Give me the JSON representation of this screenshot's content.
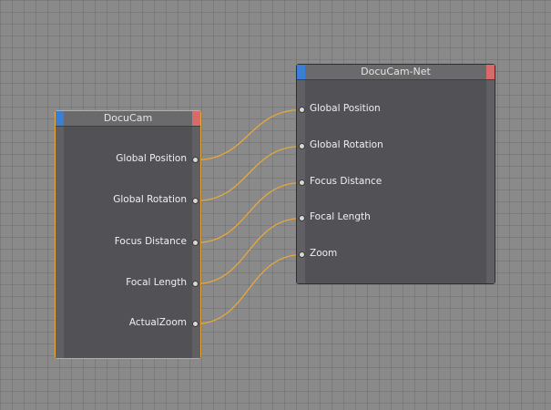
{
  "colors": {
    "wire": "#e8a83a",
    "node_body": "#525256",
    "left_corner": "#3a7fd5",
    "right_corner": "#d96a6a"
  },
  "source_node": {
    "title": "DocuCam",
    "outputs": [
      {
        "label": "Global Position"
      },
      {
        "label": "Global Rotation"
      },
      {
        "label": "Focus Distance"
      },
      {
        "label": "Focal Length"
      },
      {
        "label": "ActualZoom"
      }
    ]
  },
  "target_node": {
    "title": "DocuCam-Net",
    "inputs": [
      {
        "label": "Global Position"
      },
      {
        "label": "Global Rotation"
      },
      {
        "label": "Focus Distance"
      },
      {
        "label": "Focal Length"
      },
      {
        "label": "Zoom"
      }
    ]
  },
  "connections": [
    {
      "from": 0,
      "to": 0
    },
    {
      "from": 1,
      "to": 1
    },
    {
      "from": 2,
      "to": 2
    },
    {
      "from": 3,
      "to": 3
    },
    {
      "from": 4,
      "to": 4
    }
  ]
}
